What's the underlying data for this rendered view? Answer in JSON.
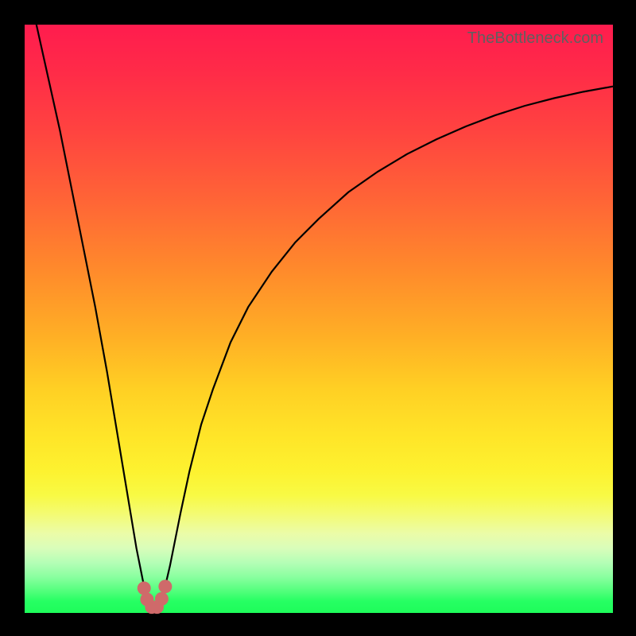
{
  "attribution": "TheBottleneck.com",
  "colors": {
    "frame": "#000000",
    "curve_stroke": "#000000",
    "dot_fill": "#cf6a6a",
    "gradient_top": "#ff1c4e",
    "gradient_bottom": "#1efc5a"
  },
  "chart_data": {
    "type": "line",
    "title": "",
    "xlabel": "",
    "ylabel": "",
    "xlim": [
      0,
      100
    ],
    "ylim": [
      0,
      100
    ],
    "series": [
      {
        "name": "bottleneck-curve",
        "x": [
          0,
          2,
          4,
          6,
          8,
          10,
          12,
          14,
          16,
          17,
          18,
          19,
          20,
          20.5,
          21,
          21.5,
          22,
          22.5,
          23,
          23.5,
          24,
          24.7,
          25.5,
          26.5,
          28,
          30,
          32,
          35,
          38,
          42,
          46,
          50,
          55,
          60,
          65,
          70,
          75,
          80,
          85,
          90,
          95,
          100
        ],
        "values": [
          108,
          100,
          91,
          82,
          72,
          62,
          52,
          41,
          29,
          23,
          17,
          11,
          6,
          3.5,
          2,
          1.2,
          0.8,
          1.1,
          1.8,
          3,
          5,
          8,
          12,
          17,
          24,
          32,
          38,
          46,
          52,
          58,
          63,
          67,
          71.5,
          75,
          78,
          80.5,
          82.7,
          84.6,
          86.2,
          87.5,
          88.6,
          89.5
        ]
      }
    ],
    "markers": [
      {
        "x": 20.3,
        "y": 4.2
      },
      {
        "x": 20.8,
        "y": 2.3
      },
      {
        "x": 21.6,
        "y": 1.0
      },
      {
        "x": 22.5,
        "y": 1.0
      },
      {
        "x": 23.3,
        "y": 2.4
      },
      {
        "x": 23.9,
        "y": 4.5
      }
    ]
  }
}
